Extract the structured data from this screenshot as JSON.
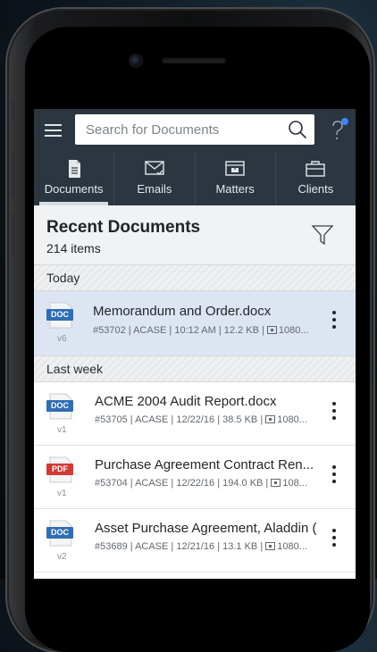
{
  "search": {
    "placeholder": "Search for Documents"
  },
  "tabs": [
    {
      "label": "Documents",
      "icon": "document-icon",
      "active": true
    },
    {
      "label": "Emails",
      "icon": "envelope-icon",
      "active": false
    },
    {
      "label": "Matters",
      "icon": "folder-icon",
      "active": false
    },
    {
      "label": "Clients",
      "icon": "briefcase-icon",
      "active": false
    }
  ],
  "header": {
    "title": "Recent Documents",
    "count": "214 items"
  },
  "sections": [
    {
      "label": "Today"
    },
    {
      "label": "Last week"
    }
  ],
  "documents": [
    {
      "type": "DOC",
      "version": "v6",
      "title": "Memorandum and Order.docx",
      "meta": "#53702 | ACASE | 10:12 AM | 12.2 KB |",
      "meta_tail": "1080...",
      "selected": true
    },
    {
      "type": "DOC",
      "version": "v1",
      "title": "ACME 2004 Audit Report.docx",
      "meta": "#53705 | ACASE | 12/22/16 | 38.5 KB |",
      "meta_tail": "1080...",
      "selected": false
    },
    {
      "type": "PDF",
      "version": "v1",
      "title": "Purchase Agreement Contract Ren...",
      "meta": "#53704 | ACASE | 12/22/16 | 194.0 KB |",
      "meta_tail": "108...",
      "selected": false
    },
    {
      "type": "DOC",
      "version": "v2",
      "title": "Asset Purchase Agreement, Aladdin (",
      "meta": "#53689 | ACASE | 12/21/16 | 13.1 KB |",
      "meta_tail": "1080...",
      "selected": false
    }
  ],
  "colors": {
    "topbar": "#2b3641",
    "doc_badge": "#2f6db5",
    "pdf_badge": "#d13a35",
    "selected_row": "#dde5f2",
    "notification_dot": "#3b86ff"
  }
}
